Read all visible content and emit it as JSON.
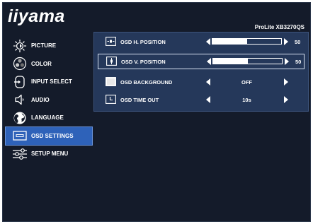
{
  "header": {
    "brand": "iiyama",
    "model": "ProLite XB3270QS"
  },
  "sidebar": {
    "items": [
      {
        "label": "PICTURE",
        "icon": "brightness-icon",
        "selected": false
      },
      {
        "label": "COLOR",
        "icon": "color-palette-icon",
        "selected": false
      },
      {
        "label": "INPUT SELECT",
        "icon": "input-icon",
        "selected": false
      },
      {
        "label": "AUDIO",
        "icon": "speaker-icon",
        "selected": false
      },
      {
        "label": "LANGUAGE",
        "icon": "globe-icon",
        "selected": false
      },
      {
        "label": "OSD SETTINGS",
        "icon": "osd-icon",
        "selected": true
      },
      {
        "label": "SETUP MENU",
        "icon": "sliders-icon",
        "selected": false
      }
    ]
  },
  "osd_settings": {
    "rows": [
      {
        "label": "OSD H. POSITION",
        "value": "50",
        "level": 0.5,
        "type": "slider",
        "selected": false
      },
      {
        "label": "OSD V. POSITION",
        "value": "50",
        "level": 0.5,
        "type": "slider",
        "selected": true
      },
      {
        "label": "OSD BACKGROUND",
        "value": "OFF",
        "type": "option",
        "selected": false
      },
      {
        "label": "OSD TIME OUT",
        "value": "10s",
        "type": "option",
        "selected": false
      }
    ]
  },
  "colors": {
    "background": "#141b2a",
    "panel": "#25385a",
    "selected": "#2e62b9",
    "text": "#ffffff"
  }
}
